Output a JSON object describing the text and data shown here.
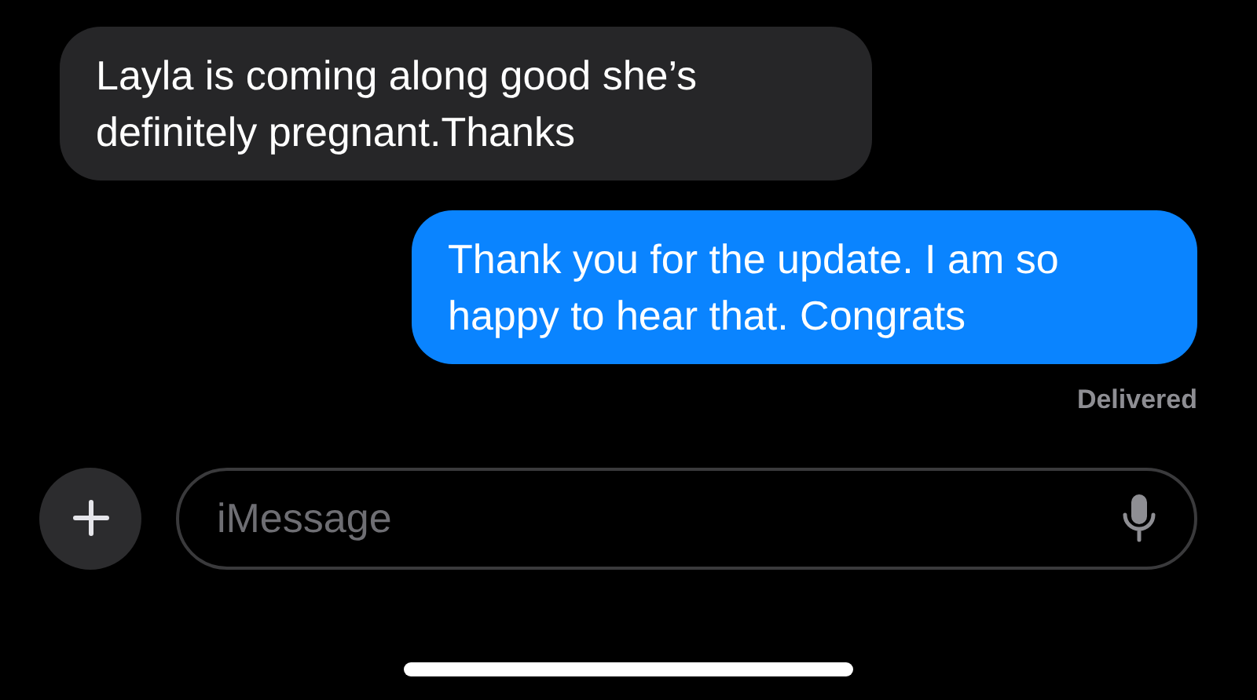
{
  "messages": [
    {
      "kind": "incoming",
      "text": "Layla is coming along good she’s definitely pregnant.Thanks"
    },
    {
      "kind": "outgoing",
      "text": "Thank you for the update. I am so happy to hear that. Congrats"
    }
  ],
  "status": "Delivered",
  "composer": {
    "placeholder": "iMessage"
  }
}
